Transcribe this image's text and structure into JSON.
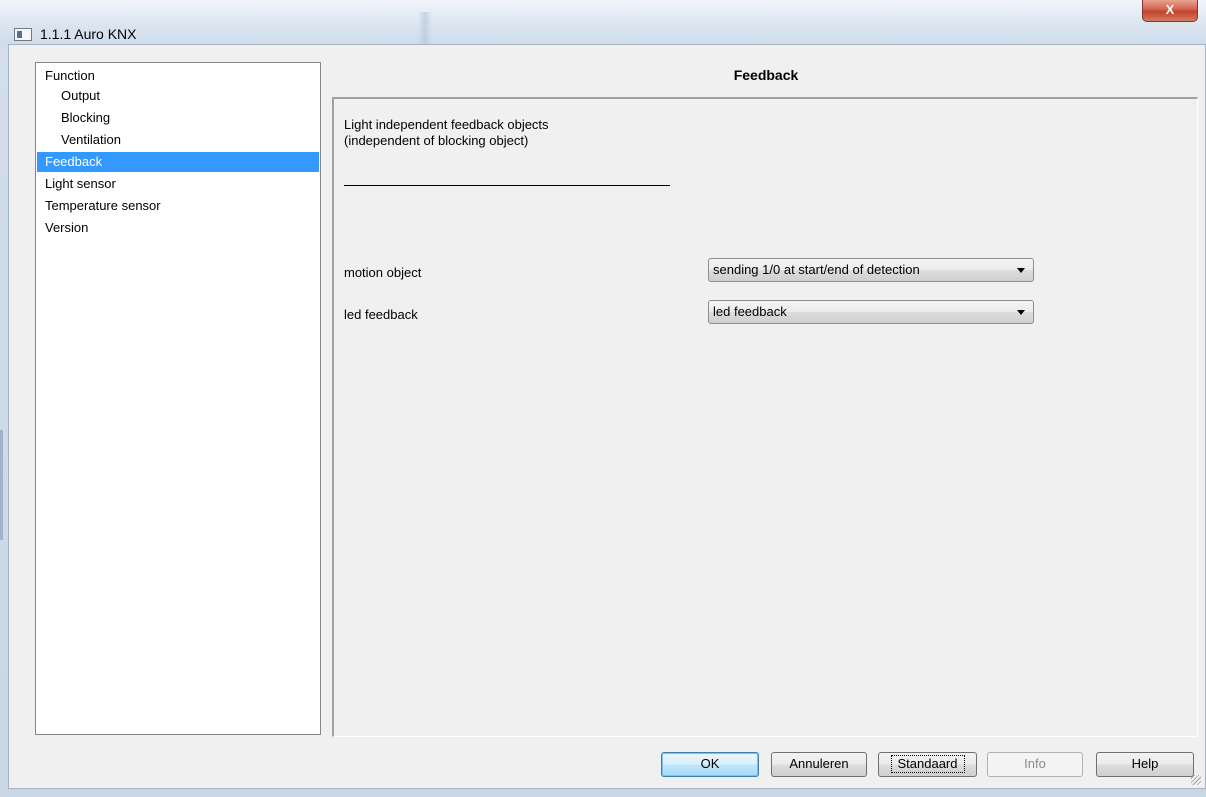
{
  "window": {
    "title": "1.1.1 Auro KNX",
    "close_label": "X"
  },
  "tree": {
    "items": [
      {
        "label": "Function",
        "level": 0,
        "selected": false
      },
      {
        "label": "Output",
        "level": 1,
        "selected": false
      },
      {
        "label": "Blocking",
        "level": 1,
        "selected": false
      },
      {
        "label": "Ventilation",
        "level": 1,
        "selected": false
      },
      {
        "label": "Feedback",
        "level": 0,
        "selected": true
      },
      {
        "label": "Light sensor",
        "level": 0,
        "selected": false
      },
      {
        "label": "Temperature sensor",
        "level": 0,
        "selected": false
      },
      {
        "label": "Version",
        "level": 0,
        "selected": false
      }
    ]
  },
  "panel": {
    "title": "Feedback",
    "description_line1": "Light independent feedback objects",
    "description_line2": "(independent of blocking object)",
    "params": [
      {
        "label": "motion object",
        "value": "sending 1/0 at start/end of detection"
      },
      {
        "label": "led feedback",
        "value": "led feedback"
      }
    ]
  },
  "buttons": {
    "ok": "OK",
    "cancel": "Annuleren",
    "default": "Standaard",
    "info": "Info",
    "help": "Help"
  },
  "colors": {
    "selection": "#3399ff",
    "close_button": "#c0442c"
  }
}
